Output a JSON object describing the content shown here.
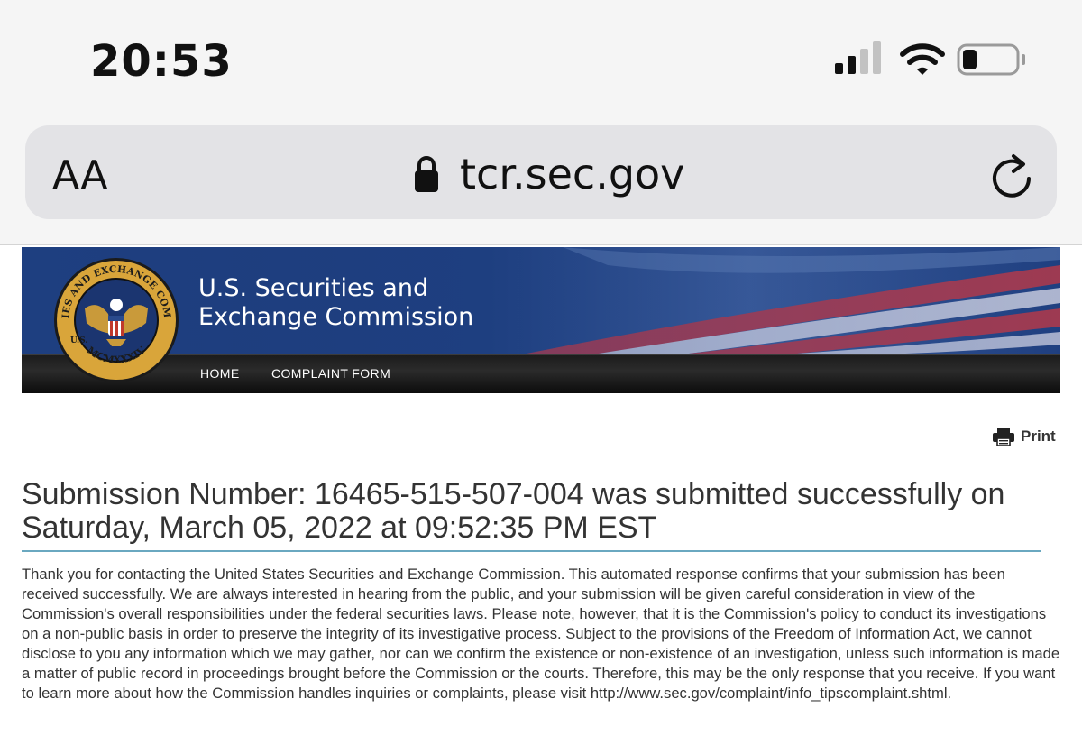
{
  "status_bar": {
    "time": "20:53",
    "icons": [
      "cellular-signal-icon",
      "wifi-icon",
      "battery-icon"
    ]
  },
  "browser": {
    "text_size_label": "AA",
    "url": "tcr.sec.gov",
    "icons": [
      "lock-icon",
      "reload-icon"
    ]
  },
  "site": {
    "title_line1": "U.S. Securities and",
    "title_line2": "Exchange Commission",
    "seal_text_top": "SECURITIES AND EXCHANGE COMMISSION",
    "seal_prefix": "U.S.",
    "seal_year": "MCMXXXIV",
    "nav": [
      "HOME",
      "COMPLAINT FORM"
    ],
    "print_label": "Print"
  },
  "content": {
    "heading": "Submission Number: 16465-515-507-004 was submitted successfully on Saturday, March 05, 2022 at 09:52:35 PM EST",
    "body": "Thank you for contacting the United States Securities and Exchange Commission.  This automated response confirms that your submission has been received successfully.  We are always interested in hearing from the public, and your submission will be given careful consideration in view of the Commission's overall responsibilities under the federal securities laws.  Please note, however, that it is the Commission's policy to conduct its investigations on a non-public basis in order to preserve the integrity of its investigative process.  Subject to the provisions of the Freedom of Information Act, we cannot disclose to you any information which we may gather, nor can we confirm the existence or non-existence of an investigation, unless such information is made a matter of public record in proceedings brought before the Commission or the courts.  Therefore, this may be the only response that you receive.  If you want to learn more about how the Commission handles inquiries or complaints, please visit http://www.sec.gov/complaint/info_tipscomplaint.shtml."
  },
  "colors": {
    "banner_blue": "#1e3f80",
    "nav_black": "#1c1c1c",
    "rule_teal": "#6aa8c0",
    "seal_gold": "#d9a53a"
  }
}
